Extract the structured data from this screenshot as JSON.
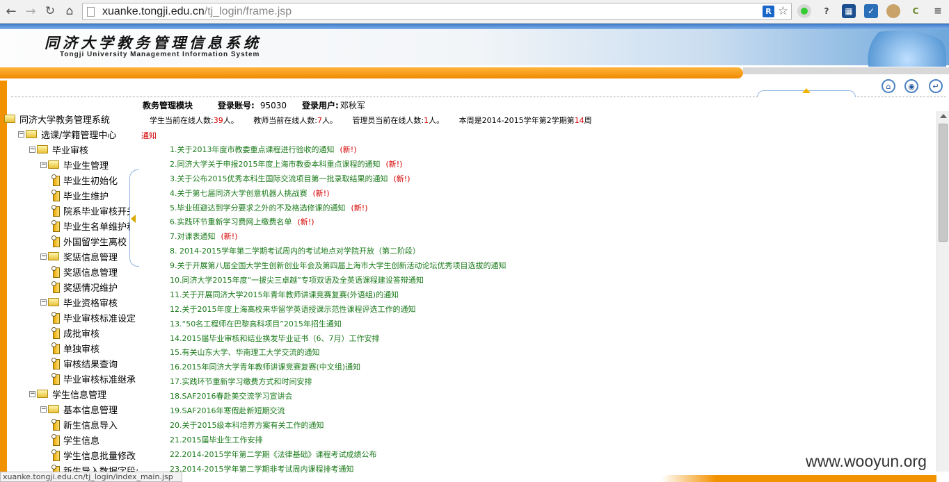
{
  "browser": {
    "url_host": "xuanke.tongji.edu.cn",
    "url_path": "/tj_login/frame.jsp",
    "status_url": "xuanke.tongji.edu.cn/tj_login/index_main.jsp"
  },
  "banner": {
    "title_cn": "同济大学教务管理信息系统",
    "title_en": "Tongji University Management Information System"
  },
  "header": {
    "module_label": "教务管理模块",
    "account_label": "登录账号:",
    "account_value": "95030",
    "user_label": "登录用户:",
    "user_value": "邓秋军",
    "students_online_label": "学生当前在线人数:",
    "students_online": "39",
    "teachers_online_label": "教师当前在线人数:",
    "teachers_online": "7",
    "admins_online_label": "管理员当前在线人数:",
    "admins_online": "1",
    "unit": "人。",
    "week_prefix": "本周是2014-2015学年第2学期第",
    "week_number": "14",
    "week_suffix": "周"
  },
  "notices_title": "通知",
  "notices": [
    {
      "text": "1.关于2013年度市教委重点课程进行验收的通知",
      "badge": "(新!)"
    },
    {
      "text": "2.同济大学关于申报2015年度上海市教委本科重点课程的通知",
      "badge": "(新!)"
    },
    {
      "text": "3.关于公布2015优秀本科生国际交流项目第一批录取结果的通知",
      "badge": "(新!)"
    },
    {
      "text": "4.关于第七届同济大学创意机器人挑战赛",
      "badge": "(新!)"
    },
    {
      "text": "5.毕业班避达到学分要求之外的不及格选修课的通知",
      "badge": "(新!)"
    },
    {
      "text": "6.实践环节重新学习费网上缴费名单",
      "badge": "(新!)"
    },
    {
      "text": "7.对课表通知",
      "badge": "(新!)"
    },
    {
      "text": "8. 2014-2015学年第二学期考试周内的考试地点对学院开放（第二阶段）",
      "badge": ""
    },
    {
      "text": "9.关于开展第八届全国大学生创新创业年会及第四届上海市大学生创新活动论坛优秀项目选拔的通知",
      "badge": ""
    },
    {
      "text": "10.同济大学2015年度“一拔尖三卓越”专项双语及全英语课程建设答辩通知",
      "badge": ""
    },
    {
      "text": "11.关于开展同济大学2015年青年教师讲课竞赛复赛(外语组)的通知",
      "badge": ""
    },
    {
      "text": "12.关于2015年度上海高校来华留学英语授课示范性课程评选工作的通知",
      "badge": ""
    },
    {
      "text": "13.“50名工程师在巴黎高科项目”2015年招生通知",
      "badge": ""
    },
    {
      "text": "14.2015届毕业审核和结业换发毕业证书（6、7月）工作安排",
      "badge": ""
    },
    {
      "text": "15.有关山东大学、华南理工大学交流的通知",
      "badge": ""
    },
    {
      "text": "16.2015年同济大学青年教师讲课竞赛复赛(中文组)通知",
      "badge": ""
    },
    {
      "text": "17.实践环节重新学习缴费方式和时间安排",
      "badge": ""
    },
    {
      "text": "18.SAF2016春赴美交流学习宣讲会",
      "badge": ""
    },
    {
      "text": "19.SAF2016年寒假赴新短期交流",
      "badge": ""
    },
    {
      "text": "20.关于2015级本科培养方案有关工作的通知",
      "badge": ""
    },
    {
      "text": "21.2015届毕业生工作安排",
      "badge": ""
    },
    {
      "text": "22.2014-2015学年第二学期《法律基础》课程考试成绩公布",
      "badge": ""
    },
    {
      "text": "23.2014-2015学年第二学期非考试周内课程排考通知",
      "badge": ""
    }
  ],
  "tree": [
    {
      "label": "同济大学教务管理系统",
      "type": "root"
    },
    {
      "label": "选课/学籍管理中心",
      "type": "folder"
    },
    {
      "label": "毕业审核",
      "type": "folder"
    },
    {
      "label": "毕业生管理",
      "type": "folder"
    },
    {
      "label": "毕业生初始化",
      "type": "leaf"
    },
    {
      "label": "毕业生维护",
      "type": "leaf"
    },
    {
      "label": "院系毕业审核开关",
      "type": "leaf"
    },
    {
      "label": "毕业生名单维护和",
      "type": "leaf"
    },
    {
      "label": "外国留学生离校",
      "type": "leaf"
    },
    {
      "label": "奖惩信息管理",
      "type": "folder"
    },
    {
      "label": "奖惩信息管理",
      "type": "leaf"
    },
    {
      "label": "奖惩情况维护",
      "type": "leaf"
    },
    {
      "label": "毕业资格审核",
      "type": "folder"
    },
    {
      "label": "毕业审核标准设定",
      "type": "leaf"
    },
    {
      "label": "成批审核",
      "type": "leaf"
    },
    {
      "label": "单独审核",
      "type": "leaf"
    },
    {
      "label": "审核结果查询",
      "type": "leaf"
    },
    {
      "label": "毕业审核标准继承",
      "type": "leaf"
    },
    {
      "label": "学生信息管理",
      "type": "folder"
    },
    {
      "label": "基本信息管理",
      "type": "folder"
    },
    {
      "label": "新生信息导入",
      "type": "leaf"
    },
    {
      "label": "学生信息",
      "type": "leaf"
    },
    {
      "label": "学生信息批量修改",
      "type": "leaf"
    },
    {
      "label": "新生导入数据字段:",
      "type": "leaf"
    }
  ],
  "toolbar_icons": [
    "home-icon",
    "lock-icon",
    "logout-icon"
  ],
  "watermark": "www.wooyun.org",
  "colors": {
    "accent_orange": "#f39200",
    "notice_green": "#1a7a1a",
    "highlight_red": "#d40000"
  }
}
